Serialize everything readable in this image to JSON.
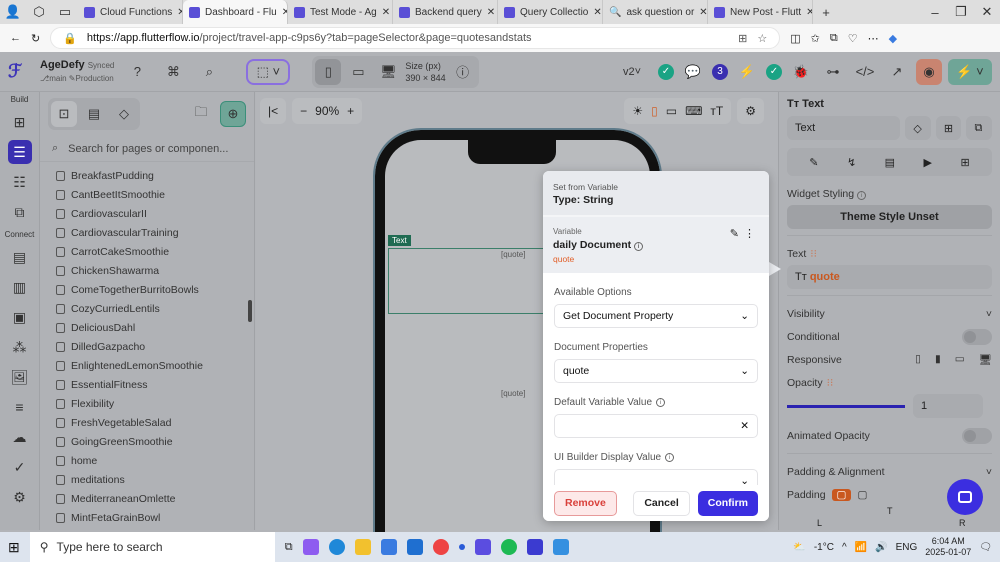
{
  "browser": {
    "tabs": [
      {
        "label": "Cloud Functions",
        "active": false
      },
      {
        "label": "Dashboard - Flu",
        "active": true
      },
      {
        "label": "Test Mode - Ag",
        "active": false
      },
      {
        "label": "Backend query",
        "active": false
      },
      {
        "label": "Query Collectio",
        "active": false
      },
      {
        "label": "ask question or",
        "active": false
      },
      {
        "label": "New Post - Flutt",
        "active": false
      }
    ],
    "url_host": "https://app.flutterflow.io",
    "url_path": "/project/travel-app-c9ps6y?tab=pageSelector&page=quotesandstats"
  },
  "toolbar": {
    "project_name": "AgeDefy",
    "sync_status": "Synced",
    "branch": "main",
    "environment": "Production",
    "size_label": "Size (px)",
    "size_value": "390 × 844",
    "version": "v2",
    "badge_count": "3"
  },
  "rail": {
    "build_label": "Build",
    "connect_label": "Connect"
  },
  "pages": {
    "search_placeholder": "Search for pages or componen...",
    "items": [
      "BreakfastPudding",
      "CantBeetItSmoothie",
      "CardiovascularII",
      "CardiovascularTraining",
      "CarrotCakeSmoothie",
      "ChickenShawarma",
      "ComeTogetherBurritoBowls",
      "CozyCurriedLentils",
      "DeliciousDahl",
      "DilledGazpacho",
      "EnlightenedLemonSmoothie",
      "EssentialFitness",
      "Flexibility",
      "FreshVegetableSalad",
      "GoingGreenSmoothie",
      "home",
      "meditations",
      "MediterraneanOmlette",
      "MintFetaGrainBowl"
    ]
  },
  "canvas": {
    "zoom": "90%",
    "text_tag": "Text",
    "placeholder1": "[quote]",
    "placeholder2": "[quote]"
  },
  "popup": {
    "header_small": "Set from Variable",
    "header_type": "Type: String",
    "variable_label": "Variable",
    "variable_name": "daily Document",
    "variable_field": "quote",
    "available_options_label": "Available Options",
    "available_options_value": "Get Document Property",
    "doc_props_label": "Document Properties",
    "doc_props_value": "quote",
    "default_value_label": "Default Variable Value",
    "default_value": "",
    "ui_builder_label": "UI Builder Display Value",
    "remove": "Remove",
    "cancel": "Cancel",
    "confirm": "Confirm"
  },
  "right_panel": {
    "title": "Text",
    "widget_name": "Text",
    "widget_styling": "Widget Styling",
    "theme_style": "Theme Style Unset",
    "text_label": "Text",
    "text_value": "quote",
    "visibility": "Visibility",
    "conditional": "Conditional",
    "responsive": "Responsive",
    "opacity": "Opacity",
    "opacity_value": "1",
    "animated_opacity": "Animated Opacity",
    "padding_alignment": "Padding & Alignment",
    "padding": "Padding",
    "pad_t": "T",
    "pad_l": "L",
    "pad_r": "R"
  },
  "taskbar": {
    "search_placeholder": "Type here to search",
    "weather": "-1°C",
    "lang": "ENG",
    "time": "6:04 AM",
    "date": "2025-01-07"
  },
  "colors": {
    "accent": "#3b2ee0",
    "variable": "#e2602a",
    "success": "#1aa384"
  }
}
